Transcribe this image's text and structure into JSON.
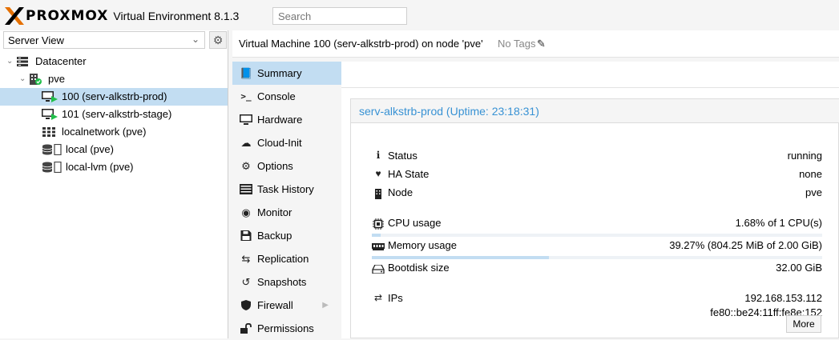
{
  "app": {
    "logo_text": "PROXMOX",
    "title": "Virtual Environment 8.1.3",
    "search_placeholder": "Search"
  },
  "sidebar": {
    "view": "Server View",
    "tree": [
      {
        "label": "Datacenter",
        "icon": "datacenter-icon"
      },
      {
        "label": "pve",
        "icon": "node-online-icon"
      },
      {
        "label": "100 (serv-alkstrb-prod)",
        "icon": "vm-running-icon",
        "selected": true
      },
      {
        "label": "101 (serv-alkstrb-stage)",
        "icon": "vm-running-icon"
      },
      {
        "label": "localnetwork (pve)",
        "icon": "network-grid-icon"
      },
      {
        "label": "local (pve)",
        "icon": "storage-icon"
      },
      {
        "label": "local-lvm (pve)",
        "icon": "storage-icon"
      }
    ]
  },
  "header": {
    "vm_title": "Virtual Machine 100 (serv-alkstrb-prod) on node 'pve'",
    "tags": "No Tags"
  },
  "menu": [
    {
      "label": "Summary",
      "icon": "book-icon",
      "active": true
    },
    {
      "label": "Console",
      "icon": "terminal-icon"
    },
    {
      "label": "Hardware",
      "icon": "monitor-icon"
    },
    {
      "label": "Cloud-Init",
      "icon": "cloud-icon"
    },
    {
      "label": "Options",
      "icon": "gear-icon"
    },
    {
      "label": "Task History",
      "icon": "list-icon"
    },
    {
      "label": "Monitor",
      "icon": "eye-icon"
    },
    {
      "label": "Backup",
      "icon": "floppy-icon"
    },
    {
      "label": "Replication",
      "icon": "retweet-icon"
    },
    {
      "label": "Snapshots",
      "icon": "history-icon"
    },
    {
      "label": "Firewall",
      "icon": "shield-icon",
      "has_submenu": true
    },
    {
      "label": "Permissions",
      "icon": "unlock-icon"
    }
  ],
  "summary": {
    "panel_title": "serv-alkstrb-prod (Uptime: 23:18:31)",
    "status_label": "Status",
    "status_value": "running",
    "ha_label": "HA State",
    "ha_value": "none",
    "node_label": "Node",
    "node_value": "pve",
    "cpu_label": "CPU usage",
    "cpu_value": "1.68% of 1 CPU(s)",
    "cpu_fraction": 0.0168,
    "mem_label": "Memory usage",
    "mem_value": "39.27% (804.25 MiB of 2.00 GiB)",
    "mem_fraction": 0.3927,
    "disk_label": "Bootdisk size",
    "disk_value": "32.00 GiB",
    "ips_label": "IPs",
    "ip_v4": "192.168.153.112",
    "ip_v6": "fe80::be24:11ff:fe8e:152",
    "more_label": "More"
  },
  "colors": {
    "accent": "#3892d4",
    "selection": "#c2ddf2",
    "logo_orange": "#e57000",
    "running_green": "#21bf4b"
  }
}
